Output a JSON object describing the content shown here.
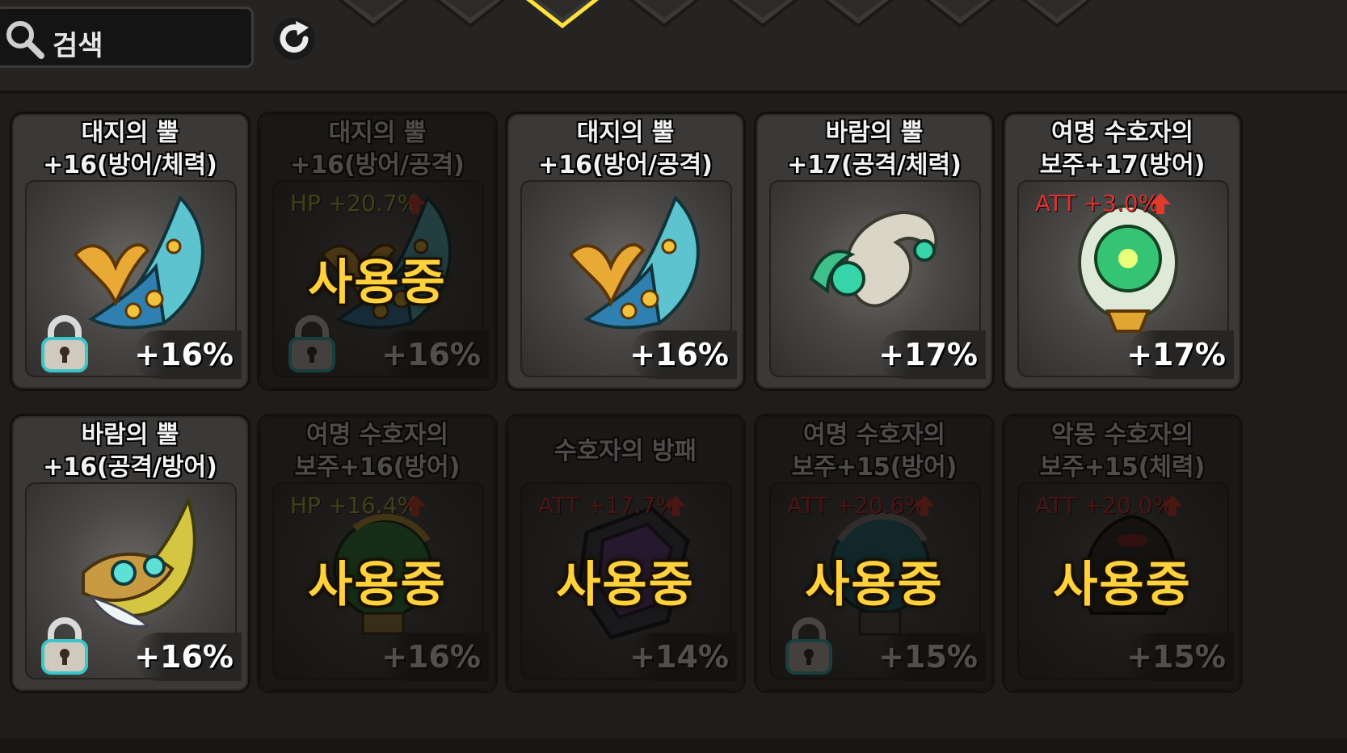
{
  "search": {
    "placeholder": "검색"
  },
  "filters": [
    {
      "icon": "red-gem-icon",
      "color": "#d03a3a"
    },
    {
      "icon": "yellow-gem-icon",
      "color": "#c8a030"
    },
    {
      "icon": "selected-gem-icon",
      "color": "#c8a030"
    },
    {
      "icon": "blue-gem-icon",
      "color": "#8a9ad0"
    },
    {
      "icon": "empty-slot-icon",
      "color": "#444"
    },
    {
      "icon": "empty-slot-icon",
      "color": "#444"
    },
    {
      "icon": "brown-gem-icon",
      "color": "#b86a3a"
    },
    {
      "icon": "orange-gem-icon",
      "color": "#e6a020"
    }
  ],
  "labels": {
    "in_use": "사용중"
  },
  "items": [
    {
      "title": "대지의 뿔\n+16(방어/체력)",
      "percent": "+16%",
      "stat": "",
      "stat_color": "",
      "in_use": false,
      "locked": true,
      "art": "earth-horn-icon"
    },
    {
      "title": "대지의 뿔\n+16(방어/공격)",
      "percent": "+16%",
      "stat": "HP +20.7%",
      "stat_color": "#c8c83a",
      "in_use": true,
      "locked": true,
      "art": "earth-horn-icon"
    },
    {
      "title": "대지의 뿔\n+16(방어/공격)",
      "percent": "+16%",
      "stat": "",
      "stat_color": "",
      "in_use": false,
      "locked": false,
      "art": "earth-horn-icon"
    },
    {
      "title": "바람의 뿔\n+17(공격/체력)",
      "percent": "+17%",
      "stat": "",
      "stat_color": "",
      "in_use": false,
      "locked": false,
      "art": "wind-horn-icon"
    },
    {
      "title": "여명 수호자의\n보주+17(방어)",
      "percent": "+17%",
      "stat": "ATT +3.0%",
      "stat_color": "#e03030",
      "in_use": false,
      "locked": false,
      "art": "dawn-orb-icon"
    },
    {
      "title": "바람의 뿔\n+16(공격/방어)",
      "percent": "+16%",
      "stat": "",
      "stat_color": "",
      "in_use": false,
      "locked": true,
      "art": "wind-feather-horn-icon"
    },
    {
      "title": "여명 수호자의\n보주+16(방어)",
      "percent": "+16%",
      "stat": "HP +16.4%",
      "stat_color": "#c8c83a",
      "in_use": true,
      "locked": false,
      "art": "green-orb-icon"
    },
    {
      "title": "수호자의 방패",
      "percent": "+14%",
      "stat": "ATT +17.7%",
      "stat_color": "#e03030",
      "in_use": true,
      "locked": false,
      "art": "guardian-shield-icon"
    },
    {
      "title": "여명 수호자의\n보주+15(방어)",
      "percent": "+15%",
      "stat": "ATT +20.6%",
      "stat_color": "#e03030",
      "in_use": true,
      "locked": true,
      "art": "teal-orb-icon"
    },
    {
      "title": "악몽 수호자의\n보주+15(체력)",
      "percent": "+15%",
      "stat": "ATT +20.0%",
      "stat_color": "#e03030",
      "in_use": true,
      "locked": false,
      "art": "nightmare-orb-icon"
    }
  ]
}
